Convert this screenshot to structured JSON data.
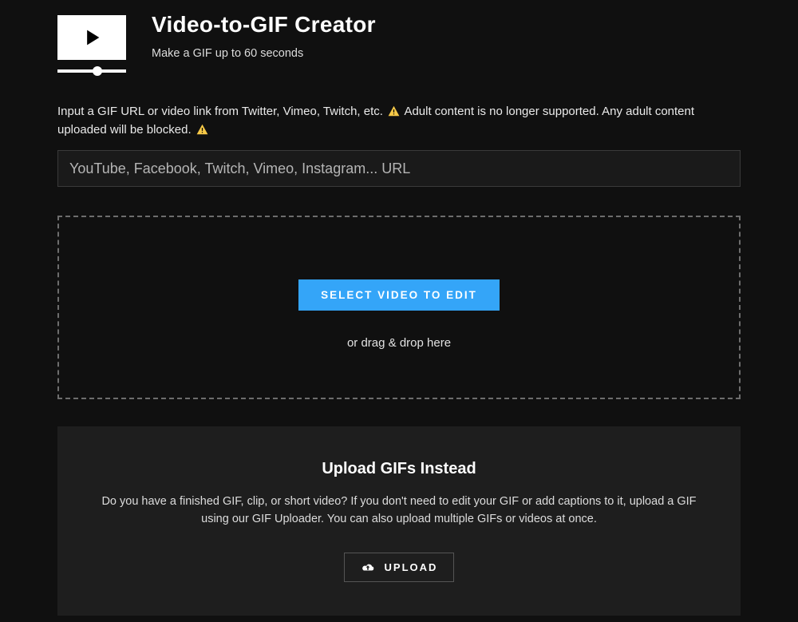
{
  "header": {
    "title": "Video-to-GIF Creator",
    "subtitle": "Make a GIF up to 60 seconds"
  },
  "disclaimer": {
    "part1": "Input a GIF URL or video link from Twitter, Vimeo, Twitch, etc.",
    "part2": "Adult content is no longer supported. Any adult content uploaded will be blocked."
  },
  "url_input": {
    "placeholder": "YouTube, Facebook, Twitch, Vimeo, Instagram... URL",
    "value": ""
  },
  "dropzone": {
    "select_label": "SELECT VIDEO TO EDIT",
    "drag_text": "or drag & drop here"
  },
  "upload_panel": {
    "heading": "Upload GIFs Instead",
    "body": "Do you have a finished GIF, clip, or short video? If you don't need to edit your GIF or add captions to it, upload a GIF using our GIF Uploader. You can also upload multiple GIFs or videos at once.",
    "button_label": "UPLOAD"
  },
  "colors": {
    "accent": "#34a5f8",
    "warn": "#f7c948"
  }
}
